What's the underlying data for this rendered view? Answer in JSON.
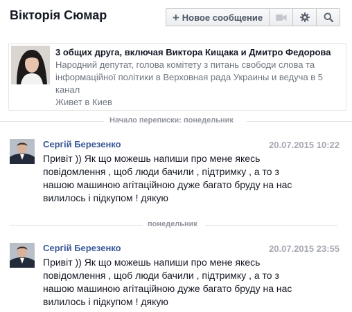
{
  "header": {
    "title": "Вікторія Сюмар",
    "new_message_label": "Новое сообщение",
    "icons": [
      "plus-icon",
      "video-camera-icon",
      "gear-icon",
      "search-icon"
    ]
  },
  "profile": {
    "mutual_friends": "3 общих друга, включая Виктора Кищака и Дмитро Федорова",
    "bio": "Народний депутат, голова комітету з питань свободи слова та інформаційної політики в Верховная рада Украины и ведуча в 5 канал",
    "lives_in": "Живет в Киев"
  },
  "conversation_start": "Начало переписки: понедельник",
  "day_divider": "понедельник",
  "messages": [
    {
      "author": "Сергій Березенко",
      "time": "20.07.2015 10:22",
      "text": "Привіт )) Як що можешь напиши про мене якесь повідомлення , щоб люди бачили , підтримку , а то з нашою машиною агітаційною дуже багато бруду на нас вилилось і підкупом !  дякую"
    },
    {
      "author": "Сергій Березенко",
      "time": "20.07.2015 23:55",
      "text": "Привіт )) Як що можешь напиши про мене якесь повідомлення , щоб люди бачили , підтримку , а то з нашою машиною агітаційною дуже багато бруду на нас вилилось і підкупом !  дякую"
    }
  ],
  "colors": {
    "author_link": "#3b5998",
    "timestamp": "#a5a9b0",
    "divider_text": "#90949c"
  }
}
